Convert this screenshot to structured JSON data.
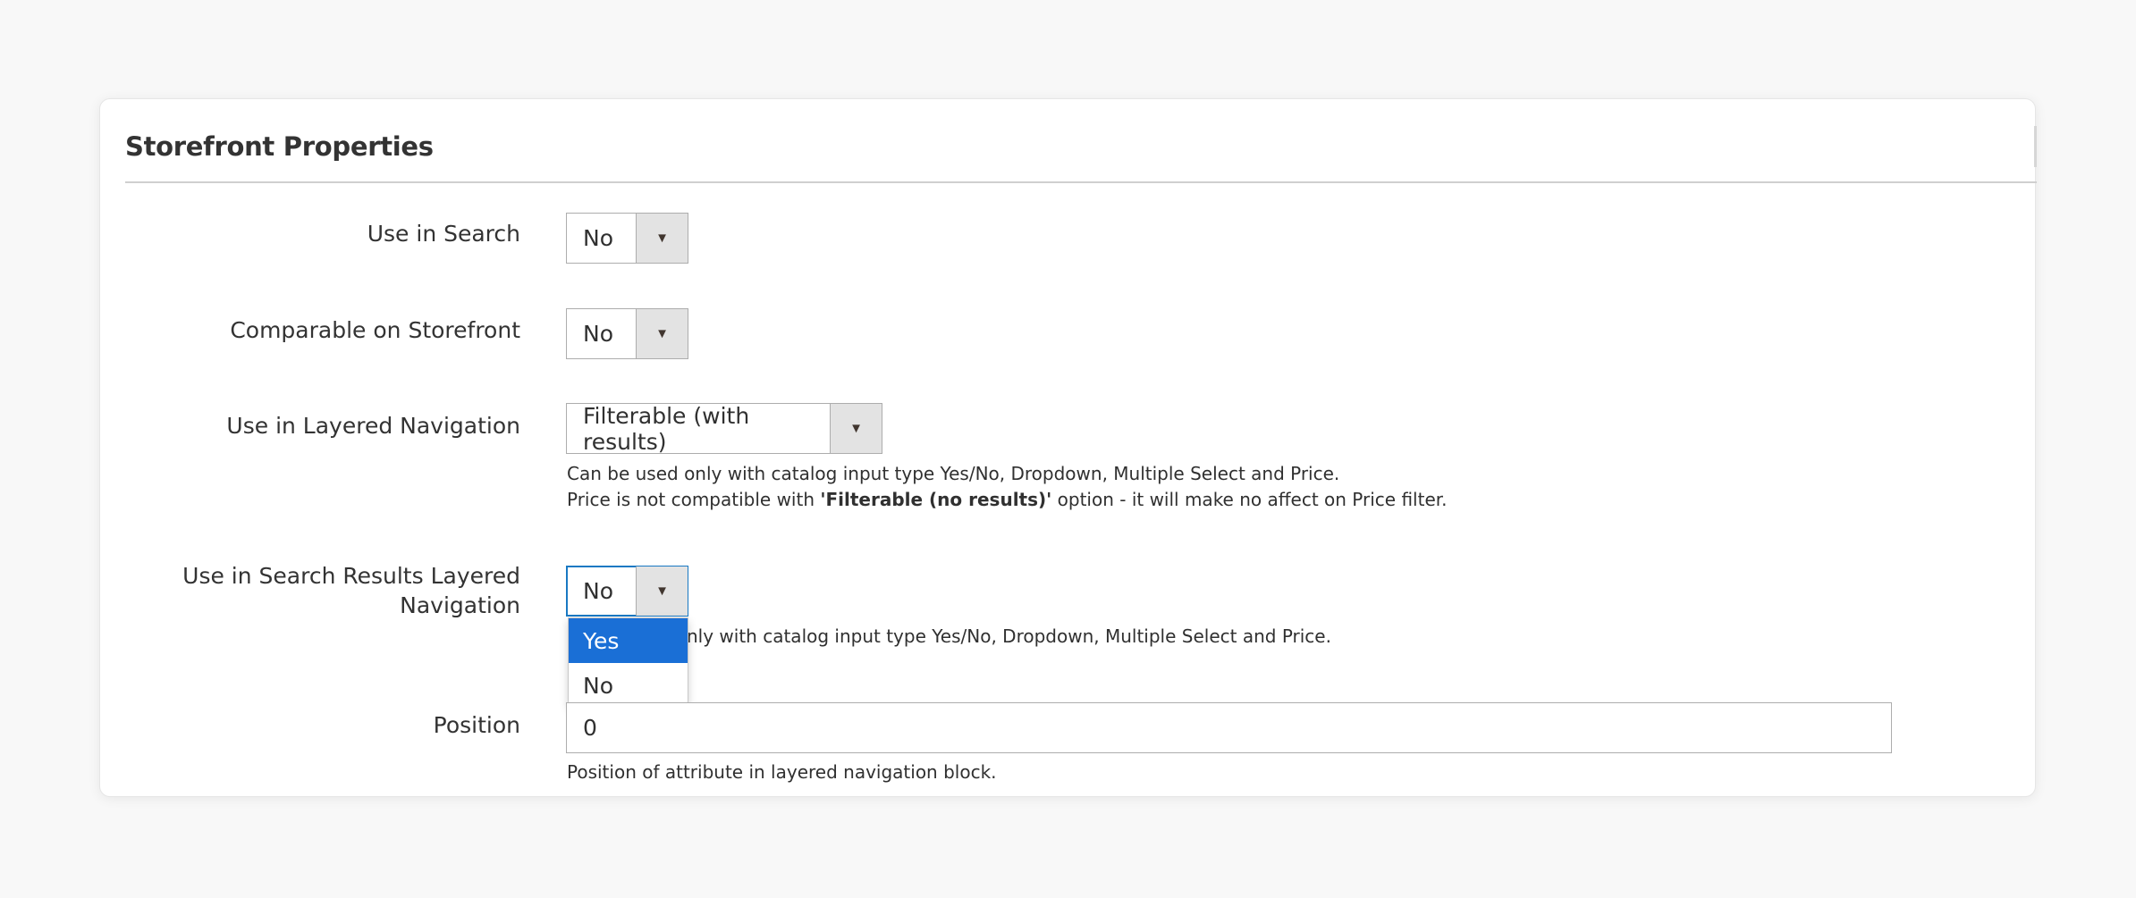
{
  "panel": {
    "title": "Storefront Properties"
  },
  "fields": {
    "use_in_search": {
      "label": "Use in Search",
      "value": "No"
    },
    "comparable": {
      "label": "Comparable on Storefront",
      "value": "No"
    },
    "layered_nav": {
      "label": "Use in Layered Navigation",
      "value": "Filterable (with results)",
      "note_line1": "Can be used only with catalog input type Yes/No, Dropdown, Multiple Select and Price.",
      "note_line2_pre": "Price is not compatible with ",
      "note_line2_bold": "'Filterable (no results)'",
      "note_line2_post": " option - it will make no affect on Price filter."
    },
    "search_results_layered_nav": {
      "label_line1": "Use in Search Results Layered",
      "label_line2": "Navigation",
      "value": "No",
      "note_visible": "nly with catalog input type Yes/No, Dropdown, Multiple Select and Price.",
      "options": [
        "Yes",
        "No"
      ],
      "highlighted_option": "Yes"
    },
    "position": {
      "label": "Position",
      "value": "0",
      "note": "Position of attribute in layered navigation block."
    }
  },
  "icons": {
    "select_arrow": "caret-down-icon"
  },
  "colors": {
    "focus_border": "#1979c3",
    "option_highlight": "#1a6fd6"
  }
}
